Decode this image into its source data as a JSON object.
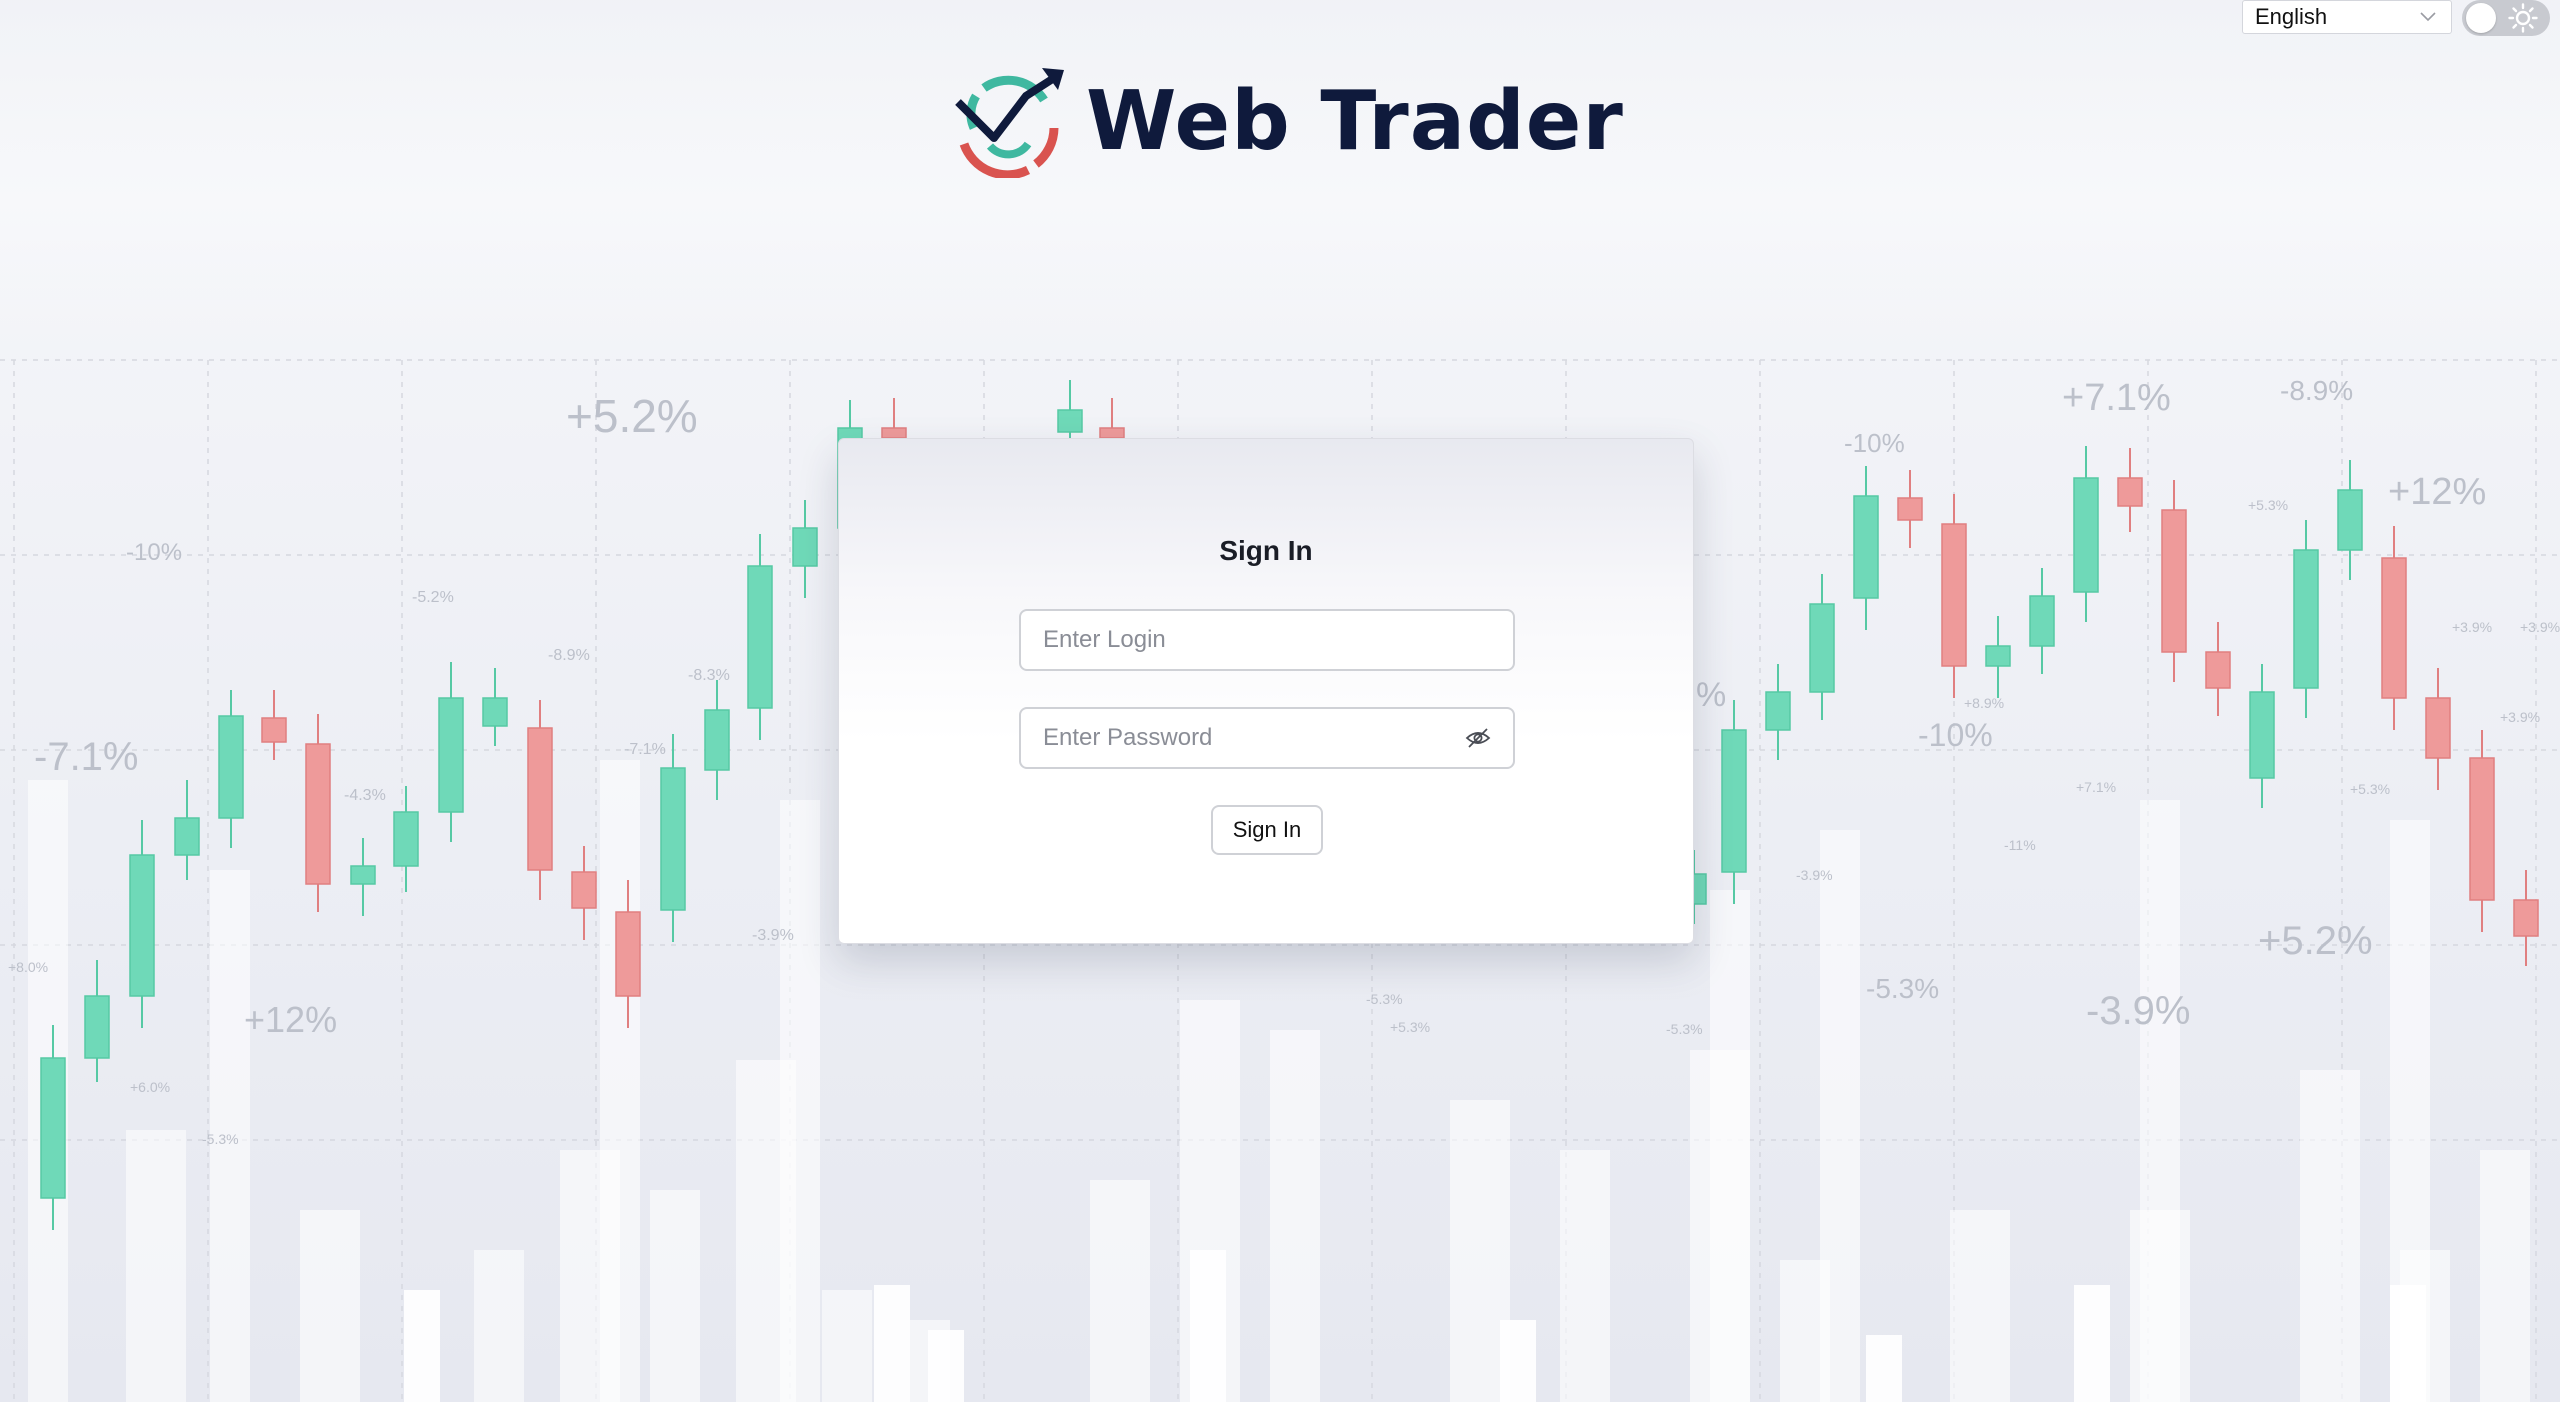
{
  "header": {
    "language": {
      "selected": "English"
    },
    "theme_toggle": {
      "icon": "sun-icon"
    }
  },
  "logo": {
    "text": "Web Trader",
    "icon": "logo-target-arrow-icon",
    "colors": {
      "teal": "#3fb8a0",
      "red": "#d9534f",
      "navy": "#0f1a3c"
    }
  },
  "signin": {
    "title": "Sign In",
    "login_placeholder": "Enter Login",
    "password_placeholder": "Enter Password",
    "password_toggle_icon": "eye-slash-icon",
    "button_label": "Sign In"
  },
  "background": {
    "up_color": "#6fd9b8",
    "down_color": "#ee9a9a",
    "labels": [
      "+5.2%",
      "-10%",
      "-7.1%",
      "+12%",
      "-5.2%",
      "-8.9%",
      "-4.3%",
      "-7.1%",
      "-3.9%",
      "-8.3%",
      "+7.1%",
      "-8.9%",
      "+12%",
      "-10%",
      "-10%",
      "+5.3%",
      "+3.9%",
      "+5.2%",
      "-5.3%",
      "-3.9%",
      "+8.9%",
      "+5.3%",
      "-11%",
      "+7.1%",
      "-3.9%",
      "-5.3%",
      "+5.3%",
      "+3.9%",
      "+8.0%",
      "-5.3%",
      "+6.0%",
      "+3.9%",
      "-5.3%",
      "%"
    ]
  }
}
